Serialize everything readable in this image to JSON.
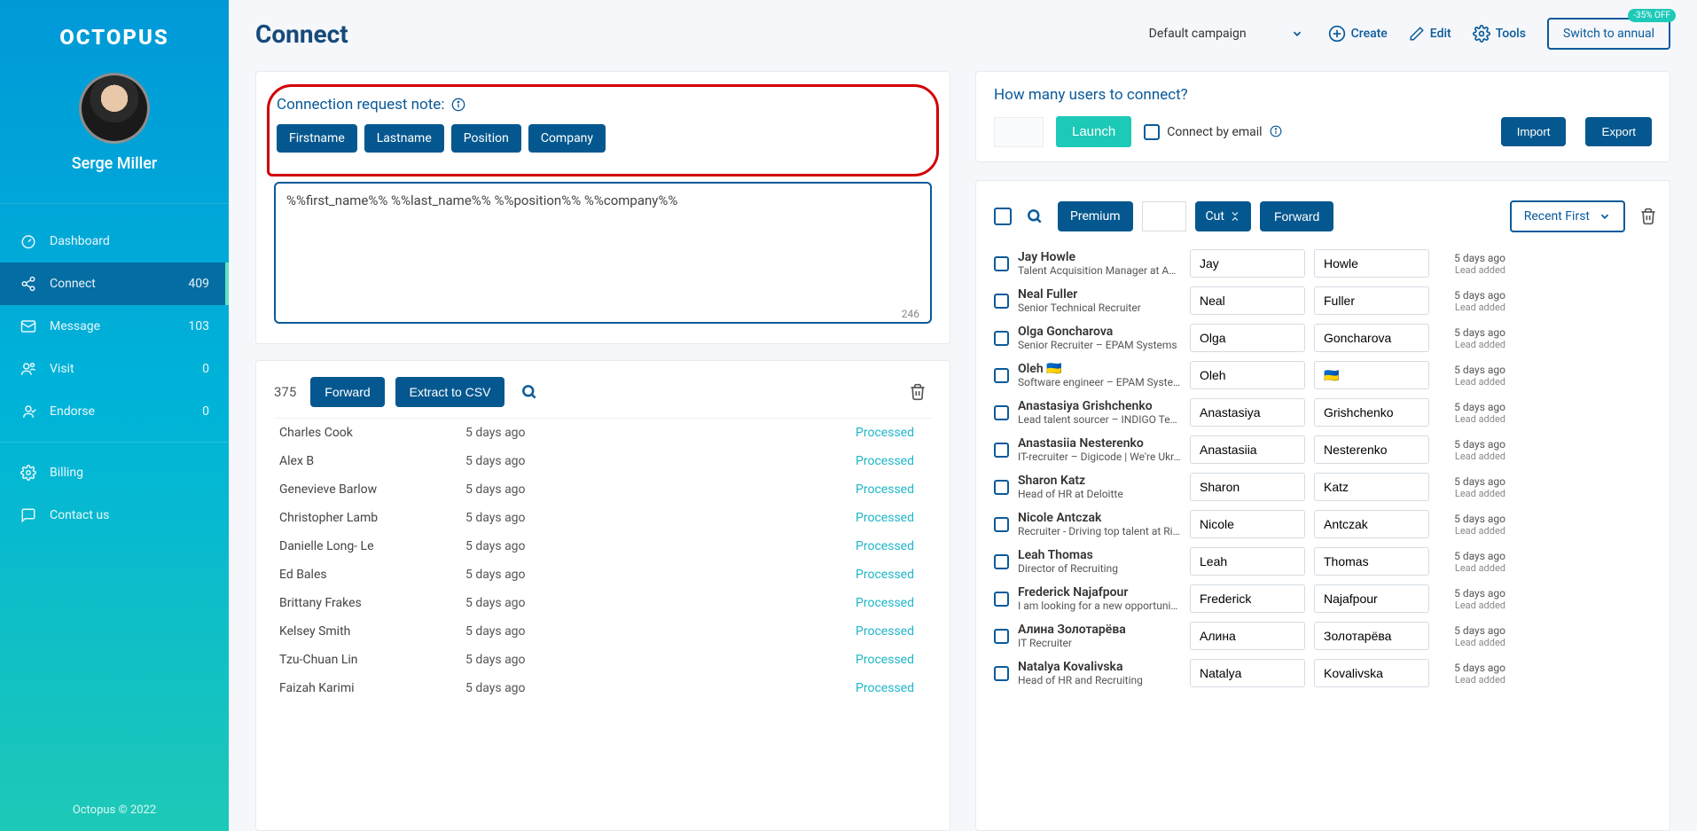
{
  "sidebar": {
    "logo": "OCTOPUS",
    "user_name": "Serge Miller",
    "items": [
      {
        "icon": "dashboard",
        "label": "Dashboard",
        "count": ""
      },
      {
        "icon": "connect",
        "label": "Connect",
        "count": "409",
        "active": true
      },
      {
        "icon": "message",
        "label": "Message",
        "count": "103"
      },
      {
        "icon": "visit",
        "label": "Visit",
        "count": "0"
      },
      {
        "icon": "endorse",
        "label": "Endorse",
        "count": "0"
      }
    ],
    "secondary": [
      {
        "icon": "billing",
        "label": "Billing"
      },
      {
        "icon": "contact",
        "label": "Contact us"
      }
    ],
    "footer": "Octopus © 2022"
  },
  "header": {
    "title": "Connect",
    "campaign": "Default campaign",
    "create": "Create",
    "edit": "Edit",
    "tools": "Tools",
    "switch_annual": "Switch to annual",
    "badge": "-35% OFF"
  },
  "note": {
    "label": "Connection request note:",
    "chips": [
      "Firstname",
      "Lastname",
      "Position",
      "Company"
    ],
    "textarea_value": "%%first_name%% %%last_name%% %%position%% %%company%%",
    "char_counter": "246"
  },
  "processed_list": {
    "count": "375",
    "forward": "Forward",
    "extract": "Extract to CSV",
    "rows": [
      {
        "name": "Charles Cook",
        "time": "5 days ago",
        "status": "Processed"
      },
      {
        "name": "Alex B",
        "time": "5 days ago",
        "status": "Processed"
      },
      {
        "name": "Genevieve Barlow",
        "time": "5 days ago",
        "status": "Processed"
      },
      {
        "name": "Christopher Lamb",
        "time": "5 days ago",
        "status": "Processed"
      },
      {
        "name": "Danielle Long- Le",
        "time": "5 days ago",
        "status": "Processed"
      },
      {
        "name": "Ed Bales",
        "time": "5 days ago",
        "status": "Processed"
      },
      {
        "name": "Brittany Frakes",
        "time": "5 days ago",
        "status": "Processed"
      },
      {
        "name": "Kelsey Smith",
        "time": "5 days ago",
        "status": "Processed"
      },
      {
        "name": "Tzu-Chuan Lin",
        "time": "5 days ago",
        "status": "Processed"
      },
      {
        "name": "Faizah Karimi",
        "time": "5 days ago",
        "status": "Processed"
      }
    ]
  },
  "launch": {
    "title": "How many users to connect?",
    "launch_btn": "Launch",
    "connect_email": "Connect by email",
    "import_btn": "Import",
    "export_btn": "Export"
  },
  "queue": {
    "premium": "Premium",
    "cut": "Cut",
    "forward": "Forward",
    "sort": "Recent First",
    "leads": [
      {
        "name": "Jay Howle",
        "title": "Talent Acquisition Manager at AE...",
        "first": "Jay",
        "last": "Howle",
        "time": "5 days ago",
        "status": "Lead added"
      },
      {
        "name": "Neal Fuller",
        "title": "Senior Technical Recruiter",
        "first": "Neal",
        "last": "Fuller",
        "time": "5 days ago",
        "status": "Lead added"
      },
      {
        "name": "Olga Goncharova",
        "title": "Senior Recruiter – EPAM Systems",
        "first": "Olga",
        "last": "Goncharova",
        "time": "5 days ago",
        "status": "Lead added"
      },
      {
        "name": "Oleh 🇺🇦",
        "title": "Software engineer – EPAM Syste...",
        "first": "Oleh",
        "last": "🇺🇦",
        "time": "5 days ago",
        "status": "Lead added"
      },
      {
        "name": "Anastasiya Grishchenko",
        "title": "Lead talent sourcer – INDIGO Tec...",
        "first": "Anastasiya",
        "last": "Grishchenko",
        "time": "5 days ago",
        "status": "Lead added"
      },
      {
        "name": "Anastasiia Nesterenko",
        "title": "IT-recruiter – Digicode | We're Ukr...",
        "first": "Anastasiia",
        "last": "Nesterenko",
        "time": "5 days ago",
        "status": "Lead added"
      },
      {
        "name": "Sharon Katz",
        "title": "Head of HR at Deloitte",
        "first": "Sharon",
        "last": "Katz",
        "time": "5 days ago",
        "status": "Lead added"
      },
      {
        "name": "Nicole Antczak",
        "title": "Recruiter - Driving top talent at Ri...",
        "first": "Nicole",
        "last": "Antczak",
        "time": "5 days ago",
        "status": "Lead added"
      },
      {
        "name": "Leah Thomas",
        "title": "Director of Recruiting",
        "first": "Leah",
        "last": "Thomas",
        "time": "5 days ago",
        "status": "Lead added"
      },
      {
        "name": "Frederick Najafpour",
        "title": "I am looking for a new opportunity.",
        "first": "Frederick",
        "last": "Najafpour",
        "time": "5 days ago",
        "status": "Lead added"
      },
      {
        "name": "Алина Золотарёва",
        "title": "IT Recruiter",
        "first": "Алина",
        "last": "Золотарёва",
        "time": "5 days ago",
        "status": "Lead added"
      },
      {
        "name": "Natalya Kovalivska",
        "title": "Head of HR and Recruiting",
        "first": "Natalya",
        "last": "Kovalivska",
        "time": "5 days ago",
        "status": "Lead added"
      }
    ]
  }
}
